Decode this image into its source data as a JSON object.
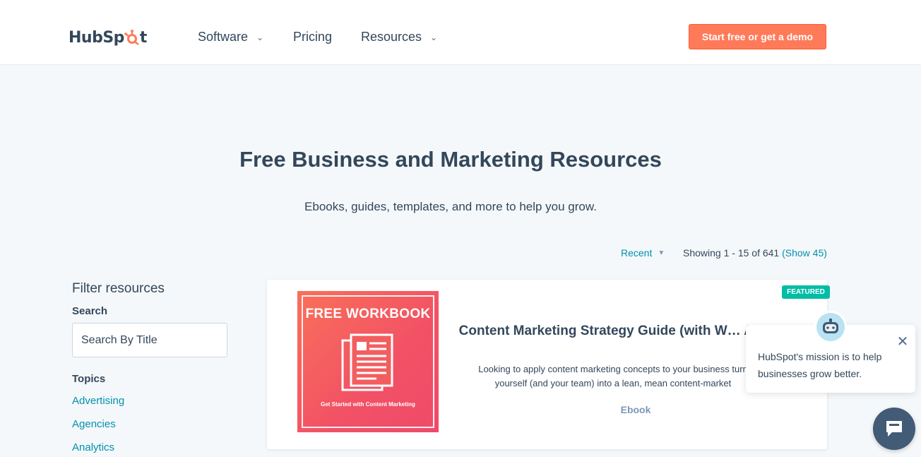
{
  "brand": {
    "logo_text_a": "HubSp",
    "logo_text_b": "t",
    "accent": "#ff7a59"
  },
  "nav": {
    "software": "Software",
    "pricing": "Pricing",
    "resources": "Resources",
    "cta": "Start free or get a demo"
  },
  "hero": {
    "title": "Free Business and Marketing Resources",
    "subtitle": "Ebooks, guides, templates, and more to help you grow."
  },
  "results": {
    "sort_selected": "Recent",
    "showing_text": "Showing 1 - 15 of 641",
    "show_more": "(Show 45)"
  },
  "filters": {
    "title": "Filter resources",
    "search_label": "Search",
    "search_placeholder": "Search By Title",
    "topics_label": "Topics",
    "topics": [
      "Advertising",
      "Agencies",
      "Analytics"
    ]
  },
  "featured_card": {
    "badge": "FEATURED",
    "thumb_title": "FREE WORKBOOK",
    "thumb_caption": "Get Started with Content Marketing",
    "title": "Content Marketing Strategy Guide (with W… Activities!)",
    "description": "Looking to apply content marketing concepts to your business turn yourself (and your team) into a lean, mean content-market",
    "type": "Ebook",
    "badge_color": "#00bda5"
  },
  "chat": {
    "message": "HubSpot's mission is to help businesses grow better.",
    "close_symbol": "✕"
  }
}
